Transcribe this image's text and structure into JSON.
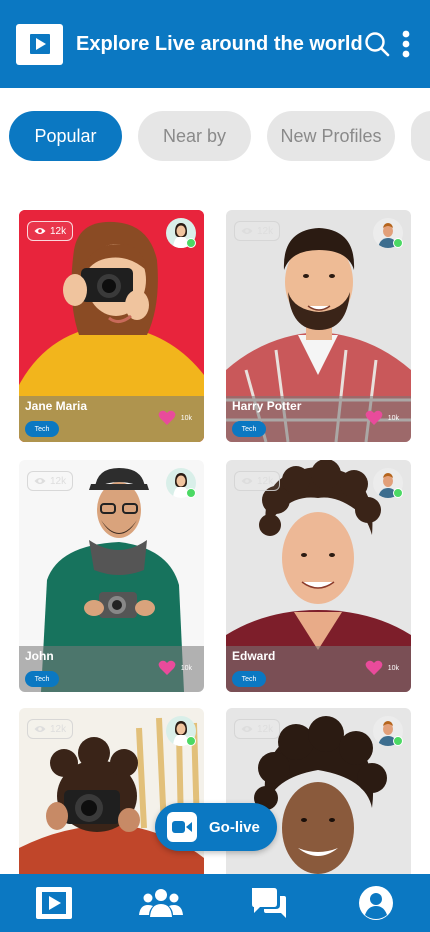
{
  "header": {
    "title": "Explore Live around the world",
    "logo_icon": "play-logo-icon",
    "search_icon": "search-icon",
    "more_icon": "more-vertical-icon"
  },
  "filters": {
    "items": [
      "Popular",
      "Near by",
      "New Profiles",
      ""
    ],
    "selected": "Popular"
  },
  "cards": [
    {
      "name": "Jane Maria",
      "views": "12k",
      "likes": "10k",
      "tag": "Tech",
      "online": true
    },
    {
      "name": "Harry Potter",
      "views": "12k",
      "likes": "10k",
      "tag": "Tech",
      "online": true
    },
    {
      "name": "John",
      "views": "12k",
      "likes": "10k",
      "tag": "Tech",
      "online": true
    },
    {
      "name": "Edward",
      "views": "12k",
      "likes": "10k",
      "tag": "Tech",
      "online": true
    },
    {
      "name": "",
      "views": "12k",
      "likes": "",
      "tag": "",
      "online": true
    },
    {
      "name": "",
      "views": "12k",
      "likes": "",
      "tag": "",
      "online": true
    }
  ],
  "golive": {
    "label": "Go-live",
    "icon": "video-camera-icon"
  },
  "nav": {
    "items": [
      "home-play-icon",
      "users-group-icon",
      "chat-bubbles-icon",
      "profile-icon"
    ]
  },
  "colors": {
    "primary": "#0b78c2",
    "chip_inactive": "#e6e6e6",
    "chip_inactive_text": "#8a8a8a",
    "like": "#e94b9b",
    "online": "#4cd964"
  }
}
